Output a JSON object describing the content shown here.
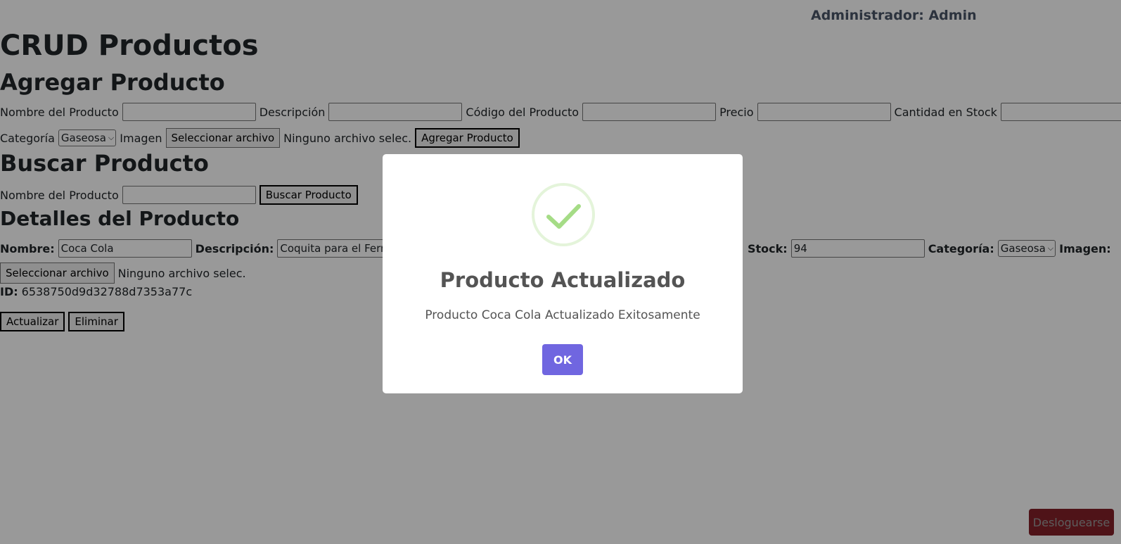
{
  "header": {
    "admin_label": "Administrador: Admin"
  },
  "titles": {
    "crud": "CRUD Productos",
    "add": "Agregar Producto",
    "search": "Buscar Producto",
    "details": "Detalles del Producto"
  },
  "add_form": {
    "name_label": "Nombre del Producto",
    "name_value": "",
    "description_label": "Descripción",
    "description_value": "",
    "code_label": "Código del Producto",
    "code_value": "",
    "price_label": "Precio",
    "price_value": "",
    "stock_label": "Cantidad en Stock",
    "stock_value": "",
    "category_label": "Categoría",
    "category_selected": "Gaseosa",
    "image_label": "Imagen",
    "file_button": "Seleccionar archivo",
    "file_status": "Ninguno archivo selec.",
    "submit_button": "Agregar Producto"
  },
  "search_form": {
    "name_label": "Nombre del Producto",
    "name_value": "",
    "submit_button": "Buscar Producto"
  },
  "details": {
    "name_label": "Nombre:",
    "name_value": "Coca Cola",
    "description_label": "Descripción:",
    "description_value": "Coquita para el Fernet",
    "stock_label": "Stock:",
    "stock_value": "94",
    "category_label": "Categoría:",
    "category_selected": "Gaseosa",
    "image_label": "Imagen:",
    "file_button": "Seleccionar archivo",
    "file_status": "Ninguno archivo selec.",
    "id_label": "ID:",
    "id_value": "6538750d9d32788d7353a77c",
    "update_button": "Actualizar",
    "delete_button": "Eliminar"
  },
  "logout_button": "Desloguearse",
  "dialog": {
    "icon": "success-check-icon",
    "title": "Producto Actualizado",
    "message": "Producto Coca Cola Actualizado Exitosamente",
    "ok_button": "OK",
    "ok_color": "#7066e0"
  }
}
